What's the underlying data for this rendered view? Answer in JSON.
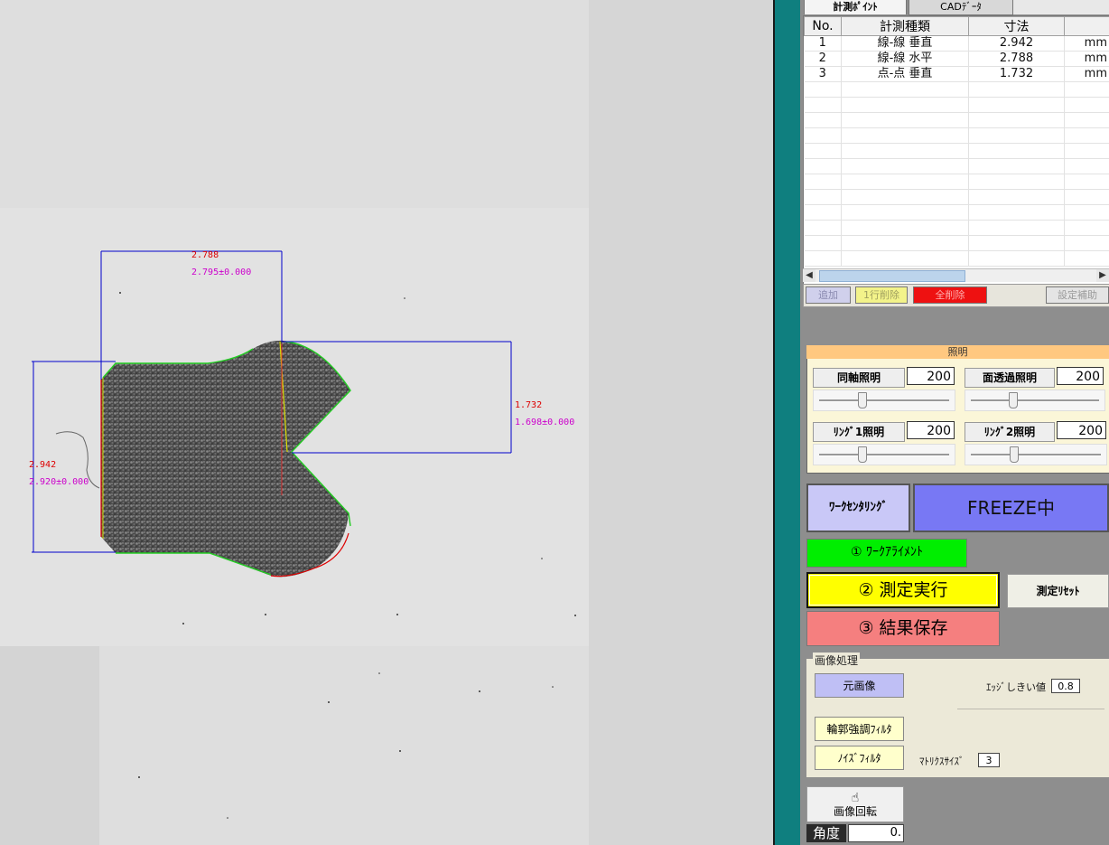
{
  "tabs": {
    "point": "計測ﾎﾟｲﾝﾄ",
    "cad": "CADﾃﾞｰﾀ"
  },
  "grid": {
    "headers": [
      "No.",
      "計測種類",
      "寸法",
      ""
    ],
    "rows": [
      {
        "no": "1",
        "kind": "線-線 垂直",
        "value": "2.942",
        "unit": "mm"
      },
      {
        "no": "2",
        "kind": "線-線 水平",
        "value": "2.788",
        "unit": "mm"
      },
      {
        "no": "3",
        "kind": "点-点 垂直",
        "value": "1.732",
        "unit": "mm"
      }
    ]
  },
  "grid_buttons": {
    "add": "追加",
    "delete_row": "1行削除",
    "delete_all": "全削除",
    "assist": "設定補助"
  },
  "lighting": {
    "title": "照明",
    "coaxial": {
      "label": "同軸照明",
      "value": "200",
      "level": 0.32
    },
    "transmit": {
      "label": "面透過照明",
      "value": "200",
      "level": 0.32
    },
    "ring1": {
      "label": "ﾘﾝｸﾞ1照明",
      "value": "200",
      "level": 0.32
    },
    "ring2": {
      "label": "ﾘﾝｸﾞ2照明",
      "value": "200",
      "level": 0.32
    }
  },
  "buttons": {
    "centering": "ﾜｰｸｾﾝﾀﾘﾝｸﾞ",
    "freeze": "FREEZE中",
    "align": "① ﾜｰｸｱﾗｲﾒﾝﾄ",
    "measure": "② 測定実行",
    "reset": "測定ﾘｾｯﾄ",
    "save": "③ 結果保存"
  },
  "processing": {
    "title": "画像処理",
    "original": "元画像",
    "edge_label": "ｴｯｼﾞしきい値",
    "edge_value": "0.8",
    "contour": "輪郭強調ﾌｨﾙﾀ",
    "noise": "ﾉｲｽﾞﾌｨﾙﾀ",
    "matrix_label": "ﾏﾄﾘｸｽｻｲｽﾞ",
    "matrix_value": "3"
  },
  "rotate": {
    "label": "画像回転",
    "angle_label": "角度",
    "angle_value": "0."
  },
  "measurements": {
    "horizontal": {
      "measured": "2.788",
      "nominal": "2.795±0.000"
    },
    "vertical_right": {
      "measured": "1.732",
      "nominal": "1.698±0.000"
    },
    "vertical_left": {
      "measured": "2.942",
      "nominal": "2.920±0.000"
    }
  },
  "colors": {
    "teal": "#0f7f7f",
    "dim_line": "#0000cc",
    "measured_text": "#dd0000",
    "nominal_text": "#cc00cc",
    "edge_green": "#22cc22",
    "edge_red": "#dd0000",
    "edge_yellow": "#dddd00"
  }
}
